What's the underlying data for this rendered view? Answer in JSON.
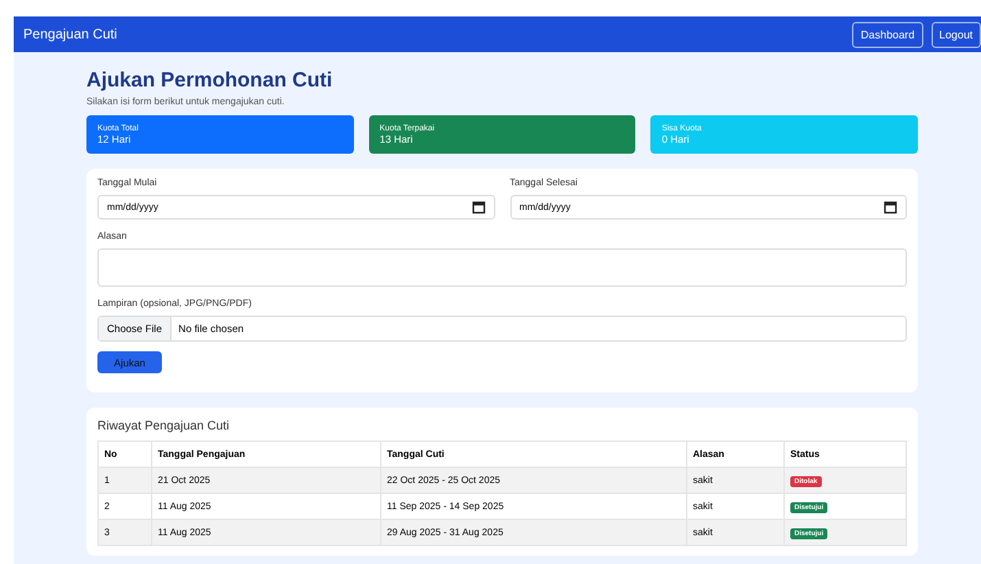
{
  "navbar": {
    "brand": "Pengajuan Cuti",
    "buttons": [
      "Dashboard",
      "Logout"
    ]
  },
  "heading": "Ajukan Permohonan Cuti",
  "subtitle": "Silakan isi form berikut untuk mengajukan cuti.",
  "quota_cards": [
    {
      "label": "Kuota Total",
      "value": "12 Hari",
      "color": "#0d6efd"
    },
    {
      "label": "Kuota Terpakai",
      "value": "13 Hari",
      "color": "#198754"
    },
    {
      "label": "Sisa Kuota",
      "value": "0 Hari",
      "color": "#0dcaf0"
    }
  ],
  "form": {
    "start_date": {
      "label": "Tanggal Mulai",
      "placeholder": "mm/dd/yyyy"
    },
    "end_date": {
      "label": "Tanggal Selesai",
      "placeholder": "mm/dd/yyyy"
    },
    "reason": {
      "label": "Alasan"
    },
    "attachment": {
      "label": "Lampiran (opsional, JPG/PNG/PDF)",
      "button": "Choose File",
      "status": "No file chosen"
    },
    "submit": "Ajukan"
  },
  "history": {
    "title": "Riwayat Pengajuan Cuti",
    "columns": [
      "No",
      "Tanggal Pengajuan",
      "Tanggal Cuti",
      "Alasan",
      "Status"
    ],
    "rows": [
      {
        "no": "1",
        "submitted": "21 Oct 2025",
        "dates": "22 Oct 2025 - 25 Oct 2025",
        "reason": "sakit",
        "status": "Ditolak",
        "kind": "rejected"
      },
      {
        "no": "2",
        "submitted": "11 Aug 2025",
        "dates": "11 Sep 2025 - 14 Sep 2025",
        "reason": "sakit",
        "status": "Disetujui",
        "kind": "approved"
      },
      {
        "no": "3",
        "submitted": "11 Aug 2025",
        "dates": "29 Aug 2025 - 31 Aug 2025",
        "reason": "sakit",
        "status": "Disetujui",
        "kind": "approved"
      }
    ]
  }
}
